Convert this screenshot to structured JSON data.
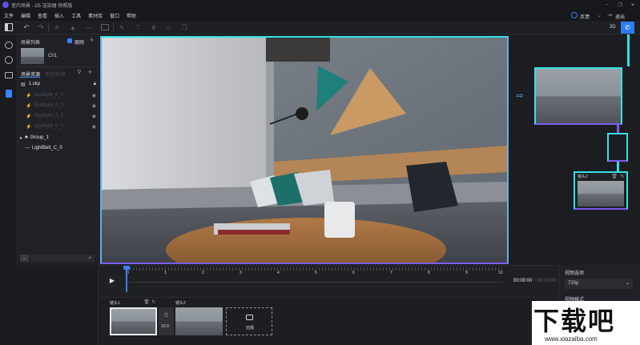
{
  "app": {
    "title": "室内场景 - D5 渲染器 快照版"
  },
  "menu": [
    "文件",
    "编辑",
    "查看",
    "插入",
    "工具",
    "素材库",
    "窗口",
    "帮助"
  ],
  "header_right": {
    "help_label": "反馈",
    "exit_label": "退出",
    "mode_3d": "3D"
  },
  "left_panel": {
    "scene_list_title": "场景列表",
    "follow_label": "跟随",
    "camera_name": "C01",
    "tabs": [
      "场景资源",
      "天空/环境"
    ],
    "tree": [
      {
        "name": "1.skp",
        "dim": false
      },
      {
        "name": "Spotlight_0_0",
        "dim": true
      },
      {
        "name": "Spotlight_0_0",
        "dim": true
      },
      {
        "name": "Spotlight_0_1",
        "dim": true
      },
      {
        "name": "Spotlight_0_2",
        "dim": true
      },
      {
        "name": "Group_1",
        "dim": false
      },
      {
        "name": "LightBelt_C_0",
        "dim": false
      }
    ]
  },
  "right_panel": {
    "shot_label": "镜头2"
  },
  "timeline": {
    "ticks": [
      "0",
      "1",
      "2",
      "3",
      "4",
      "5",
      "6",
      "7",
      "8",
      "9",
      "10"
    ],
    "current_time": "00:00:00",
    "total_time": "00:10:00",
    "progress": 0.0
  },
  "shots": {
    "shot1_label": "镜头1",
    "shot2_label": "镜头2",
    "transition_duration": "10.0",
    "add_shot_label": "拍摄"
  },
  "settings": {
    "video_settings_title": "视频选项",
    "resolution": "720p",
    "video_format_title": "视频格式"
  },
  "watermark": {
    "text": "下载吧",
    "url": "www.xiazaiba.com"
  },
  "colors": {
    "accent": "#3a82f7",
    "cyan": "#35e0e8",
    "purple": "#7a5cf0"
  }
}
